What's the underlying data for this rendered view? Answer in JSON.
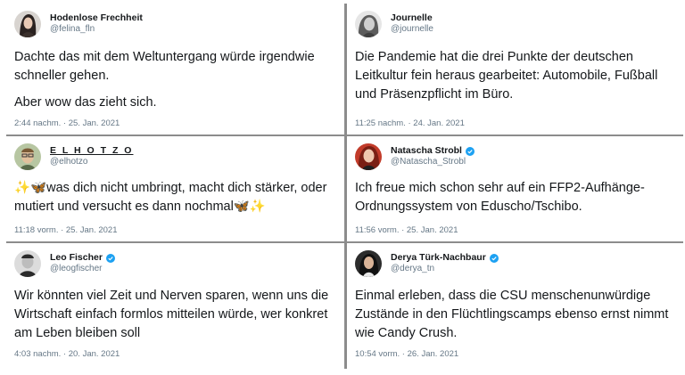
{
  "tweets": [
    {
      "name": "Hodenlose Frechheit",
      "handle": "@felina_fln",
      "verified": false,
      "paragraphs": [
        "Dachte das mit dem Weltuntergang würde irgendwie schneller gehen.",
        "Aber wow das zieht sich."
      ],
      "date": "2:44 nachm. · 25. Jan. 2021"
    },
    {
      "name": "Journelle",
      "handle": "@journelle",
      "verified": false,
      "paragraphs": [
        "Die Pandemie hat die drei Punkte der deutschen Leitkultur fein heraus gearbeitet: Automobile, Fußball und Präsenzpflicht im Büro."
      ],
      "date": "11:25 nachm. · 24. Jan. 2021"
    },
    {
      "name": "E L H O T Z O",
      "handle": "@elhotzo",
      "verified": false,
      "text_main": "was dich nicht umbringt, macht dich stärker, oder mutiert und versucht es dann nochmal",
      "emoji_sparkles": "✨",
      "emoji_butterfly": "🦋",
      "date": "11:18 vorm. · 25. Jan. 2021"
    },
    {
      "name": "Natascha Strobl",
      "handle": "@Natascha_Strobl",
      "verified": true,
      "paragraphs": [
        "Ich freue mich schon sehr auf ein FFP2-Aufhänge-Ordnungssystem von Eduscho/Tschibo."
      ],
      "date": "11:56 vorm. · 25. Jan. 2021"
    },
    {
      "name": "Leo Fischer",
      "handle": "@leogfischer",
      "verified": true,
      "paragraphs": [
        "Wir könnten viel Zeit und Nerven sparen, wenn uns die Wirtschaft einfach formlos mitteilen würde, wer konkret am Leben bleiben soll"
      ],
      "date": "4:03 nachm. · 20. Jan. 2021"
    },
    {
      "name": "Derya Türk-Nachbaur",
      "handle": "@derya_tn",
      "verified": true,
      "paragraphs": [
        "Einmal erleben, dass die CSU menschenunwürdige Zustände in den Flüchtlingscamps ebenso ernst nimmt wie Candy Crush."
      ],
      "date": "10:54 vorm. · 26. Jan. 2021"
    }
  ]
}
